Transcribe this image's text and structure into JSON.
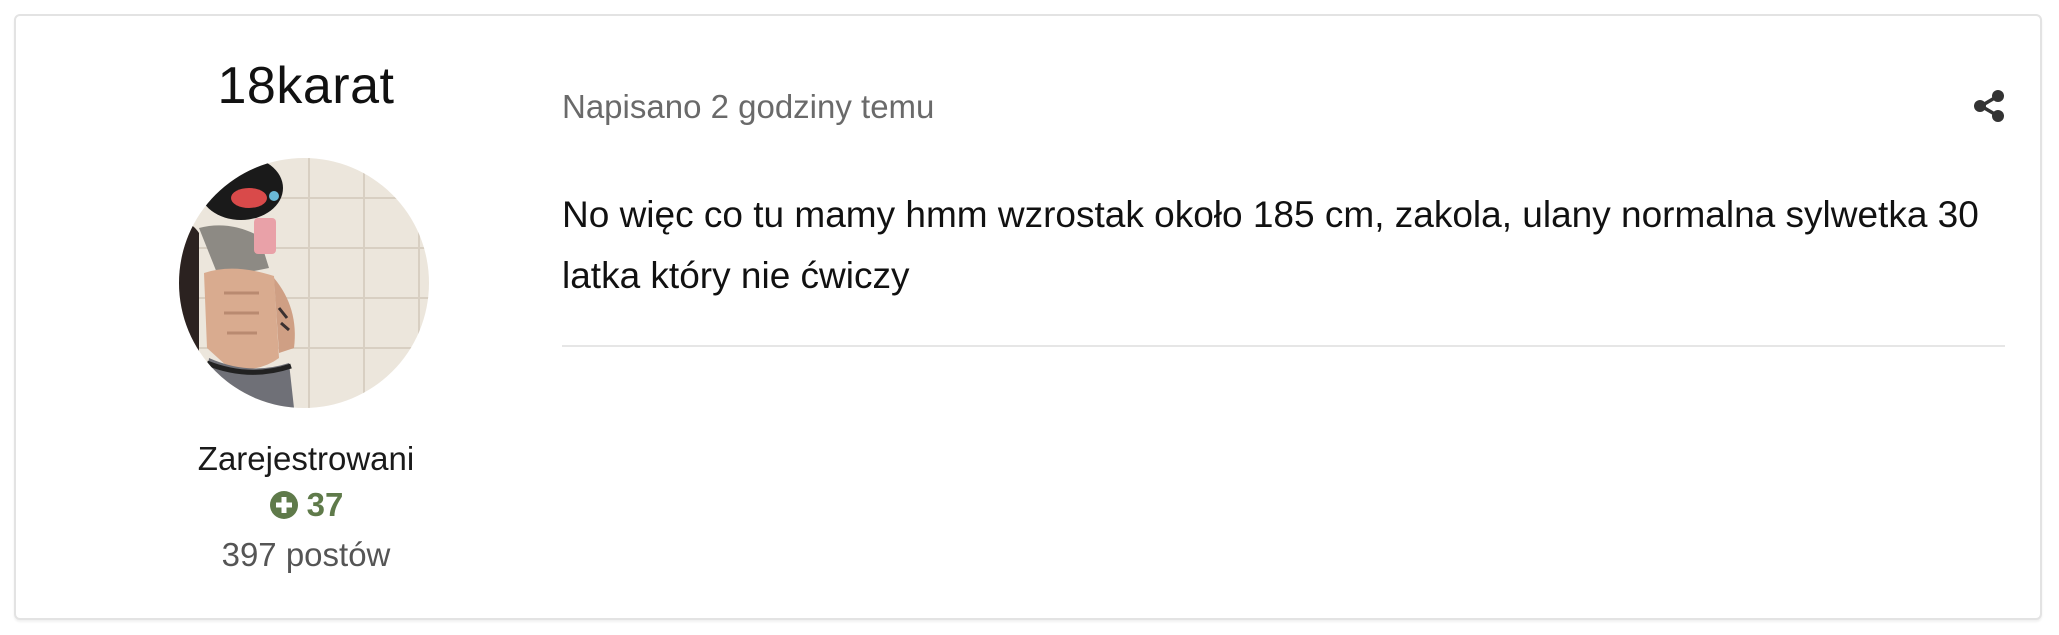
{
  "author": {
    "name": "18karat",
    "group": "Zarejestrowani",
    "reputation": "37",
    "post_count": "397 postów"
  },
  "post": {
    "meta": "Napisano 2 godziny temu",
    "body": "No więc co tu mamy hmm wzrostak około 185 cm, zakola, ulany normalna sylwetka 30 latka który nie ćwiczy"
  },
  "icons": {
    "reputation": "plus-circle-icon",
    "share": "share-icon"
  },
  "colors": {
    "reputation": "#5f7a4a",
    "meta_text": "#6a6a6a",
    "border": "#e3e3e3"
  }
}
